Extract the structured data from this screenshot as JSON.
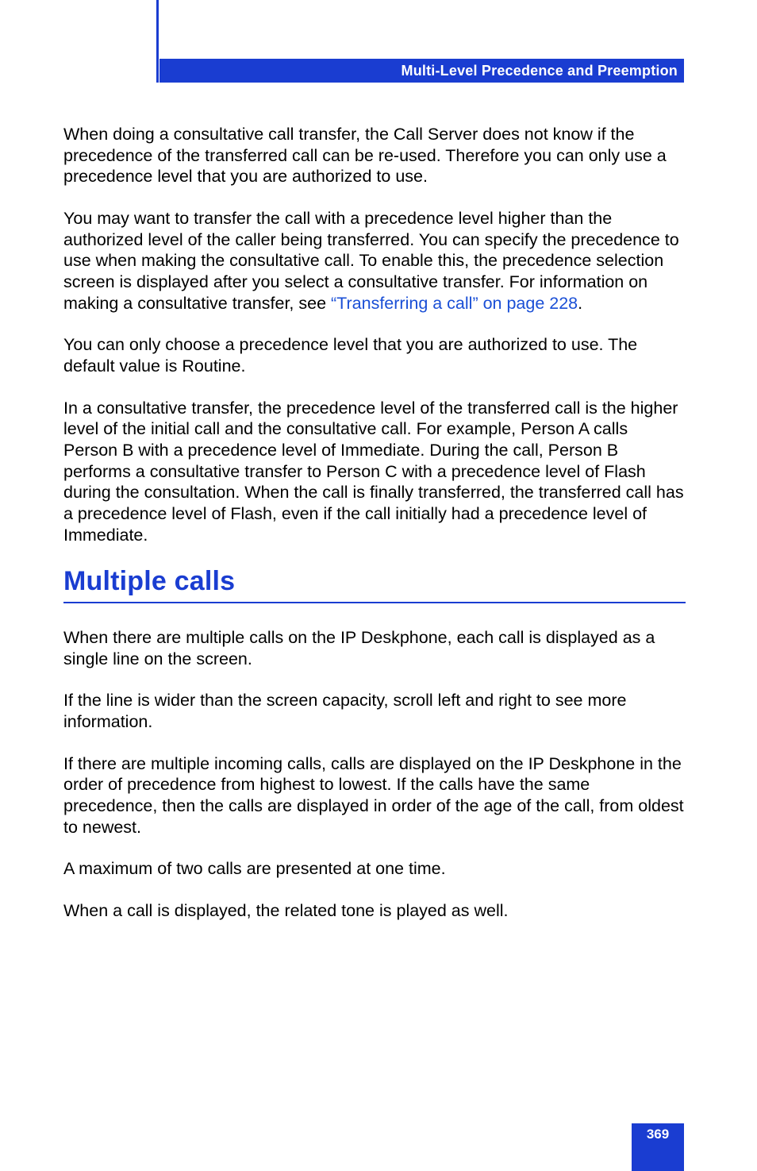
{
  "header": {
    "title": "Multi-Level Precedence and Preemption"
  },
  "body": {
    "p1": "When doing a consultative call transfer, the Call Server does not know if the precedence of the transferred call can be re-used. Therefore you can only use a precedence level that you are authorized to use.",
    "p2a": "You may want to transfer the call with a precedence level higher than the authorized level of the caller being transferred. You can specify the precedence to use when making the consultative call. To enable this, the precedence selection screen is displayed after you select a consultative transfer. For information on making a consultative transfer, see ",
    "p2_link": "“Transferring a call” on page 228",
    "p2b": ".",
    "p3": "You can only choose a precedence level that you are authorized to use. The default value is Routine.",
    "p4": "In a consultative transfer, the precedence level of the transferred call is the higher level of the initial call and the consultative call. For example, Person A calls Person B with a precedence level of Immediate. During the call, Person B performs a consultative transfer to Person C with a precedence level of Flash during the consultation. When the call is finally transferred, the transferred call has a precedence level of Flash, even if the call initially had a precedence level of Immediate.",
    "h2": "Multiple calls",
    "p5": "When there are multiple calls on the IP Deskphone, each call is displayed as a single line on the screen.",
    "p6": "If the line is wider than the screen capacity, scroll left and right to see more information.",
    "p7": "If there are multiple incoming calls, calls are displayed on the IP Deskphone in the order of precedence from highest to lowest. If the calls have the same precedence, then the calls are displayed in order of the age of the call, from oldest to newest.",
    "p8": "A maximum of two calls are presented at one time.",
    "p9": "When a call is displayed, the related tone is played as well."
  },
  "footer": {
    "page_number": "369"
  }
}
